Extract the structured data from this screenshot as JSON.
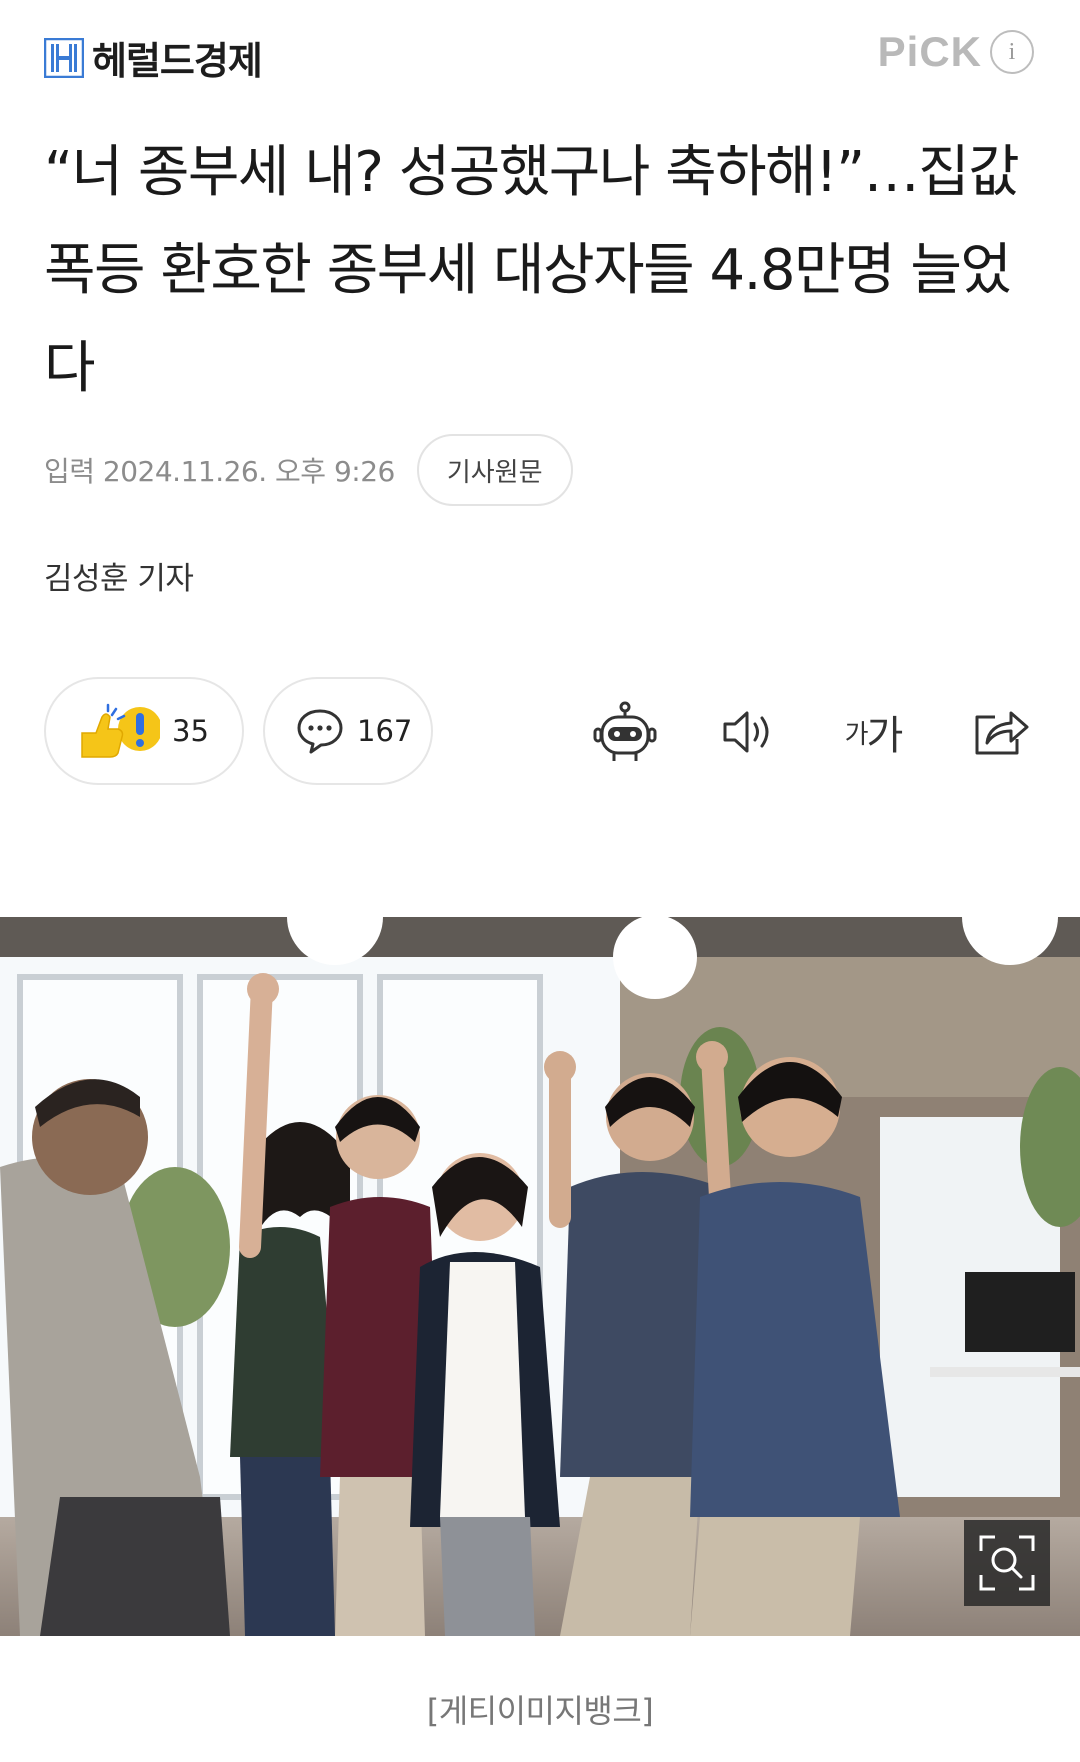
{
  "header": {
    "logo_text": "헤럴드경제",
    "pick_label": "PiCK",
    "info_label": "i"
  },
  "article": {
    "title": "“너 종부세 내? 성공했구나 축하해!”…집값 폭등 환호한 종부세 대상자들 4.8만명 늘었다",
    "date": "입력 2024.11.26. 오후 9:26",
    "original_button": "기사원문",
    "reporter": "김성훈 기자"
  },
  "actions": {
    "reaction_count": "35",
    "comment_count": "167",
    "font_small": "가",
    "font_large": "가"
  },
  "photo": {
    "caption": "[게티이미지뱅크]"
  },
  "colors": {
    "logo_blue": "#3a7bd5",
    "pick_gray": "#b9b9b9",
    "reaction_yellow": "#f5c518"
  }
}
